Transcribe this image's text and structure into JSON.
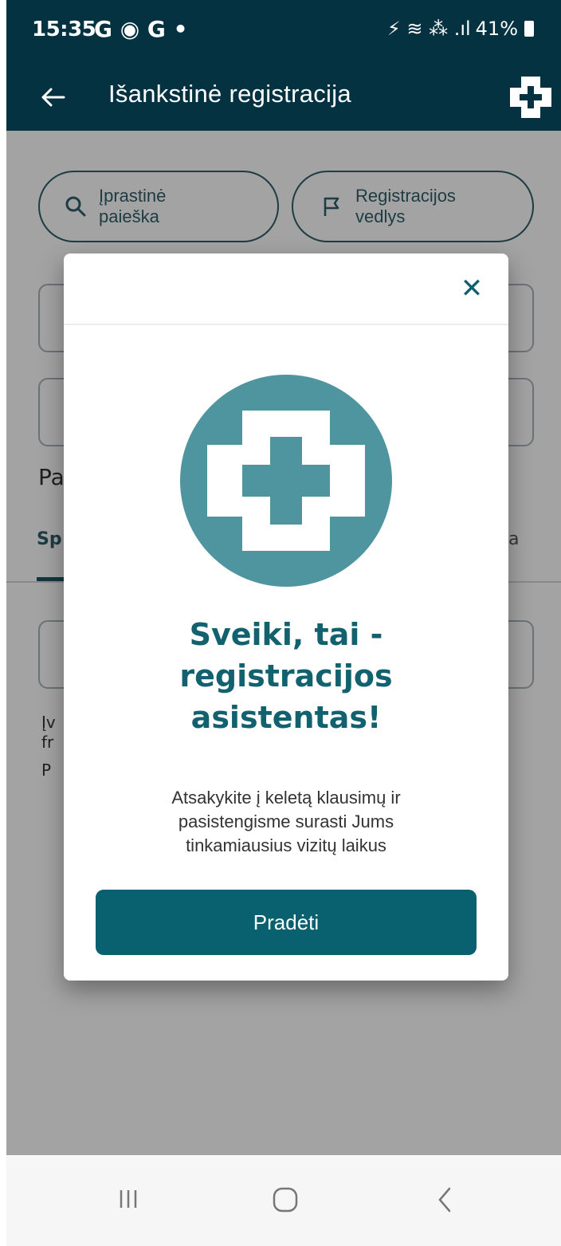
{
  "status_bar": {
    "time": "15:35",
    "app_icons": "G ◉ G •",
    "indicators": "⚡ ≋ ⁂ .ıl",
    "battery": "41%"
  },
  "app_bar": {
    "title": "Išankstinė registracija",
    "back_icon": "arrow-left-icon",
    "brand_icon": "medical-cross-icon"
  },
  "page": {
    "search_buttons": [
      {
        "label_line_1": "Įprastinė",
        "label_line_2": "paieška",
        "icon": "search-icon"
      },
      {
        "label_line_1": "Registracijos",
        "label_line_2": "vedlys",
        "icon": "flag-icon"
      }
    ],
    "section_label": "Pa",
    "tabs": [
      {
        "label": "Sp"
      },
      {
        "label": "a"
      }
    ],
    "truncated_lines": [
      "Įv",
      "fr",
      "P"
    ]
  },
  "modal": {
    "close_label": "✕",
    "heading_lines": [
      "Sveiki, tai -",
      "registracijos",
      "asistentas!"
    ],
    "body_lines": [
      "Atsakykite į keletą klausimų ir",
      "pasistengisme surasti Jums",
      "tinkamiausius vizitų laikus"
    ],
    "start_label": "Pradėti"
  },
  "colors": {
    "app_bar": "#043240",
    "accent": "#09606e",
    "circle": "#4f95a0"
  }
}
